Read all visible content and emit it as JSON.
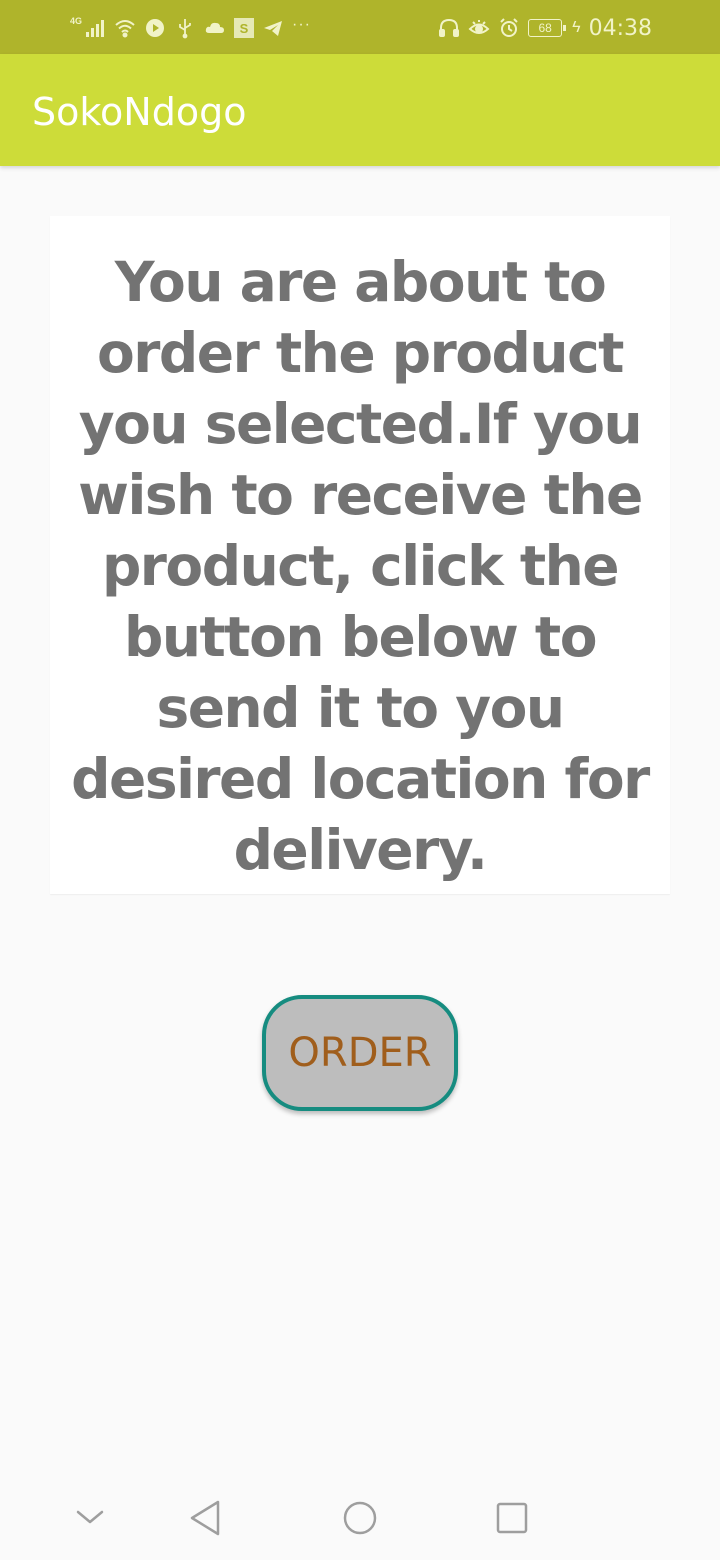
{
  "status_bar": {
    "network_label": "4G",
    "icons": [
      "signal-icon",
      "wifi-icon",
      "play-icon",
      "usb-icon",
      "cloud-icon",
      "s-app-icon",
      "telegram-icon",
      "more-icon",
      "headphones-icon",
      "eye-icon",
      "alarm-icon",
      "battery-icon",
      "charging-icon"
    ],
    "s_badge": "S",
    "more": "···",
    "battery_level": "68",
    "time": "04:38"
  },
  "app_bar": {
    "title": "SokoNdogo"
  },
  "message": {
    "text": "You are about to order the product you selected.If you wish to receive the product, click the button below to send it to you desired location for delivery."
  },
  "order_button": {
    "label": "ORDER"
  },
  "nav_bar": {
    "icons": [
      "dropdown-chevron-icon",
      "back-icon",
      "home-icon",
      "recents-icon"
    ]
  },
  "colors": {
    "status_bar": "#afb42b",
    "app_bar": "#cddc39",
    "button_border": "#168c80",
    "button_text": "#a05e1c",
    "message_text": "#737373"
  }
}
